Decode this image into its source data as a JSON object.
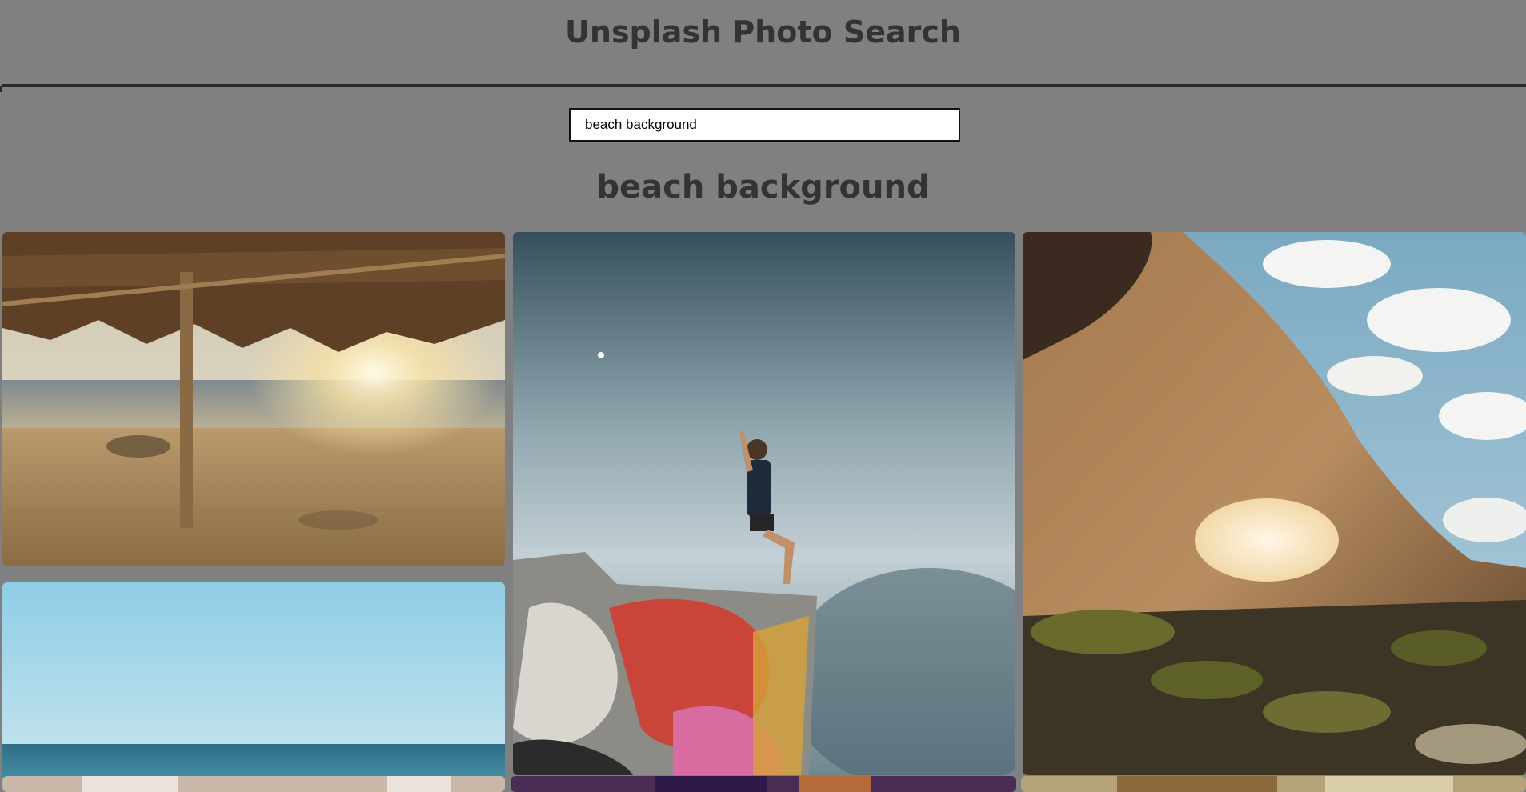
{
  "app": {
    "title": "Unsplash Photo Search"
  },
  "search": {
    "value": "beach background",
    "placeholder": ""
  },
  "results": {
    "heading": "beach background",
    "photos": [
      {
        "subject": "thatched beach umbrella at sunset on sandy shore"
      },
      {
        "subject": "person sitting on graffiti wall raising peace sign against cloudy sky"
      },
      {
        "subject": "rocky sea arch with sunlight and mossy rocks"
      },
      {
        "subject": "blue sky above calm ocean horizon"
      },
      {
        "subject": "partially visible photo"
      },
      {
        "subject": "partially visible photo"
      },
      {
        "subject": "partially visible photo"
      }
    ]
  },
  "colors": {
    "background": "#808080",
    "heading_text": "#333333",
    "divider": "#2a2a2a",
    "input_border": "#111111"
  }
}
